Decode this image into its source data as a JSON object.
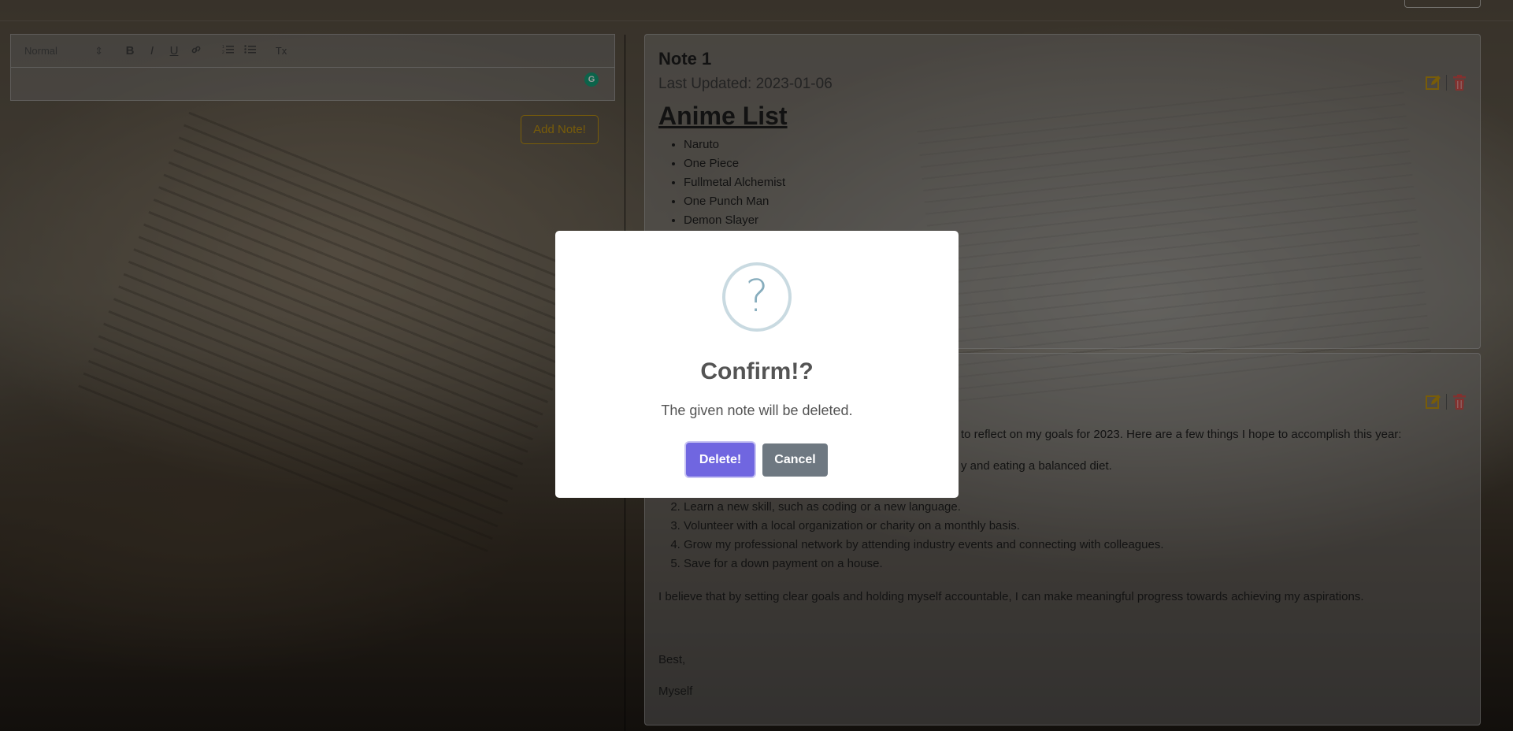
{
  "editor": {
    "format_select": "Normal",
    "toolbar_icons": [
      "bold-icon",
      "italic-icon",
      "underline-icon",
      "link-icon",
      "ordered-list-icon",
      "bullet-list-icon",
      "clear-format-icon"
    ],
    "bold": "B",
    "italic": "I",
    "underline": "U",
    "clear": "Tx",
    "grammarly": "G",
    "add_button": "Add Note!"
  },
  "notes": [
    {
      "title": "Note 1",
      "date": "Last Updated: 2023-01-06",
      "heading": "Anime List",
      "items": [
        "Naruto",
        "One Piece",
        "Fullmetal Alchemist",
        "One Punch Man",
        "Demon Slayer"
      ]
    },
    {
      "intro": "to reflect on my goals for 2023. Here are a few things I hope to accomplish this year:",
      "intro2": "y and eating a balanced diet.",
      "items": [
        "Learn a new skill, such as coding or a new language.",
        "Volunteer with a local organization or charity on a monthly basis.",
        "Grow my professional network by attending industry events and connecting with colleagues.",
        "Save for a down payment on a house."
      ],
      "paragraph": "I believe that by setting clear goals and holding myself accountable, I can make meaningful progress towards achieving my aspirations.",
      "closing": "Best,",
      "signature": "Myself"
    }
  ],
  "colors": {
    "accent_warning": "#c99a10",
    "delete_red": "#d9534f",
    "confirm_purple": "#7066e0",
    "cancel_gray": "#6e7881"
  },
  "modal": {
    "icon": "question-icon",
    "icon_glyph": "?",
    "title": "Confirm!?",
    "text": "The given note will be deleted.",
    "confirm_label": "Delete!",
    "cancel_label": "Cancel"
  }
}
